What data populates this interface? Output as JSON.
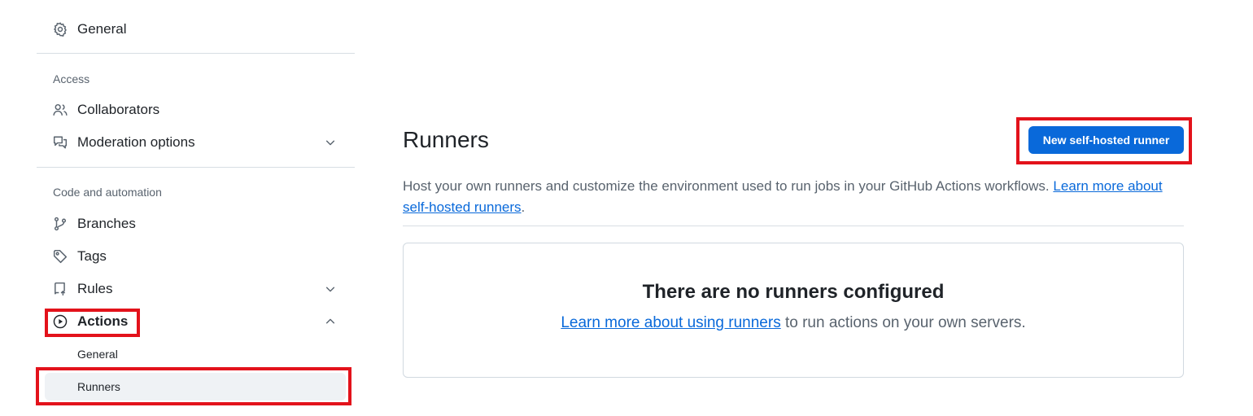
{
  "sidebar": {
    "general_label": "General",
    "access_section": "Access",
    "collaborators_label": "Collaborators",
    "moderation_label": "Moderation options",
    "code_section": "Code and automation",
    "branches_label": "Branches",
    "tags_label": "Tags",
    "rules_label": "Rules",
    "actions_label": "Actions",
    "actions_sub": {
      "general_label": "General",
      "runners_label": "Runners"
    },
    "icons": [
      "gear-icon",
      "people-icon",
      "comment-discussion-icon",
      "git-branch-icon",
      "tag-icon",
      "repo-push-icon",
      "play-icon",
      "chevron-down-icon",
      "chevron-up-icon"
    ]
  },
  "main": {
    "title": "Runners",
    "new_runner_button": "New self-hosted runner",
    "description": "Host your own runners and customize the environment used to run jobs in your GitHub Actions workflows.",
    "description_link": "Learn more about self-hosted runners",
    "description_end": ".",
    "empty_title": "There are no runners configured",
    "empty_link": "Learn more about using runners",
    "empty_text": " to run actions on your own servers."
  },
  "colors": {
    "accent": "#0969da",
    "highlight": "#e3121b",
    "selected_bg": "#eff2f5"
  }
}
